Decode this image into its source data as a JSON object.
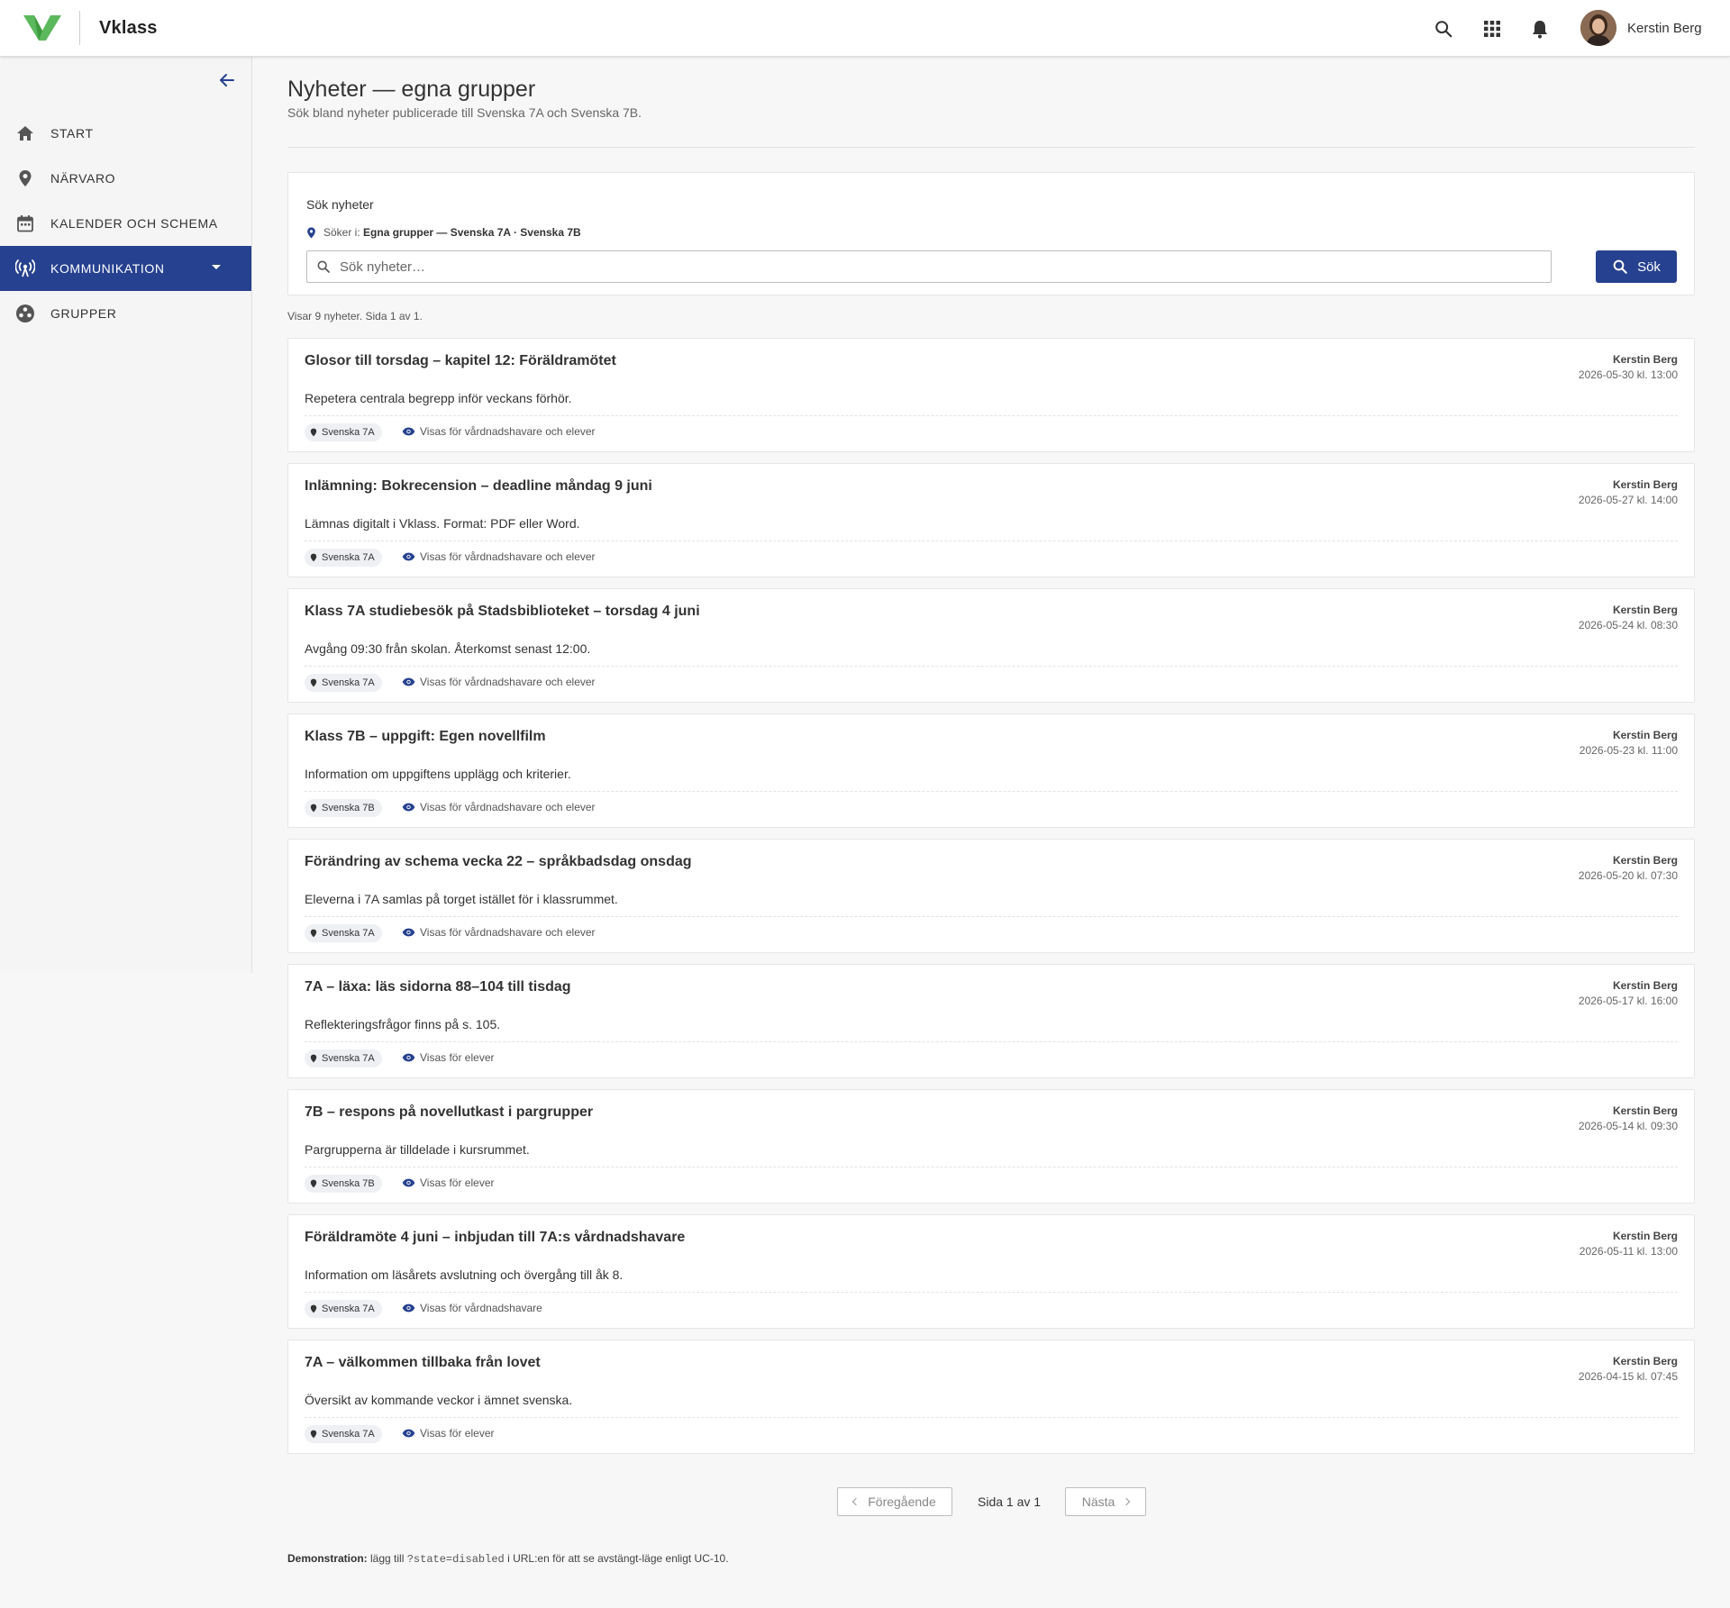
{
  "app": {
    "brand": "Vklass",
    "user_name": "Kerstin Berg"
  },
  "colors": {
    "primary": "#26418f",
    "logo_green": "#5cb85c"
  },
  "topbar_icons": [
    "search-icon",
    "apps-grid-icon",
    "bell-icon"
  ],
  "sidebar": {
    "items": [
      {
        "label": "START",
        "icon": "home-icon",
        "active": false
      },
      {
        "label": "NÄRVARO",
        "icon": "location-pin-icon",
        "active": false
      },
      {
        "label": "KALENDER OCH SCHEMA",
        "icon": "calendar-icon",
        "active": false
      },
      {
        "label": "KOMMUNIKATION",
        "icon": "broadcast-icon",
        "active": true
      },
      {
        "label": "GRUPPER",
        "icon": "groups-icon",
        "active": false
      }
    ]
  },
  "page": {
    "title": "Nyheter — egna grupper",
    "subtitle": "Sök bland nyheter publicerade till Svenska 7A och Svenska 7B."
  },
  "search": {
    "label": "Sök nyheter",
    "scope_prefix": "Söker i:",
    "scope_value": "Egna grupper — Svenska 7A · Svenska 7B",
    "placeholder": "Sök nyheter…",
    "value": "",
    "button": "Sök"
  },
  "results_info": "Visar 9 nyheter. Sida 1 av 1.",
  "news": [
    {
      "title": "Glosor till torsdag – kapitel 12: Föräldramötet",
      "author": "Kerstin Berg",
      "date": "2026-05-30 kl. 13:00",
      "body": "Repetera centrala begrepp inför veckans förhör.",
      "group": "Svenska 7A",
      "visibility": "Visas för vårdnadshavare och elever"
    },
    {
      "title": "Inlämning: Bokrecension – deadline måndag 9 juni",
      "author": "Kerstin Berg",
      "date": "2026-05-27 kl. 14:00",
      "body": "Lämnas digitalt i Vklass. Format: PDF eller Word.",
      "group": "Svenska 7A",
      "visibility": "Visas för vårdnadshavare och elever"
    },
    {
      "title": "Klass 7A studiebesök på Stadsbiblioteket – torsdag 4 juni",
      "author": "Kerstin Berg",
      "date": "2026-05-24 kl. 08:30",
      "body": "Avgång 09:30 från skolan. Återkomst senast 12:00.",
      "group": "Svenska 7A",
      "visibility": "Visas för vårdnadshavare och elever"
    },
    {
      "title": "Klass 7B – uppgift: Egen novellfilm",
      "author": "Kerstin Berg",
      "date": "2026-05-23 kl. 11:00",
      "body": "Information om uppgiftens upplägg och kriterier.",
      "group": "Svenska 7B",
      "visibility": "Visas för vårdnadshavare och elever"
    },
    {
      "title": "Förändring av schema vecka 22 – språkbadsdag onsdag",
      "author": "Kerstin Berg",
      "date": "2026-05-20 kl. 07:30",
      "body": "Eleverna i 7A samlas på torget istället för i klassrummet.",
      "group": "Svenska 7A",
      "visibility": "Visas för vårdnadshavare och elever"
    },
    {
      "title": "7A – läxa: läs sidorna 88–104 till tisdag",
      "author": "Kerstin Berg",
      "date": "2026-05-17 kl. 16:00",
      "body": "Reflekteringsfrågor finns på s. 105.",
      "group": "Svenska 7A",
      "visibility": "Visas för elever"
    },
    {
      "title": "7B – respons på novellutkast i pargrupper",
      "author": "Kerstin Berg",
      "date": "2026-05-14 kl. 09:30",
      "body": "Pargrupperna är tilldelade i kursrummet.",
      "group": "Svenska 7B",
      "visibility": "Visas för elever"
    },
    {
      "title": "Föräldramöte 4 juni – inbjudan till 7A:s vårdnadshavare",
      "author": "Kerstin Berg",
      "date": "2026-05-11 kl. 13:00",
      "body": "Information om läsårets avslutning och övergång till åk 8.",
      "group": "Svenska 7A",
      "visibility": "Visas för vårdnadshavare"
    },
    {
      "title": "7A – välkommen tillbaka från lovet",
      "author": "Kerstin Berg",
      "date": "2026-04-15 kl. 07:45",
      "body": "Översikt av kommande veckor i ämnet svenska.",
      "group": "Svenska 7A",
      "visibility": "Visas för elever"
    }
  ],
  "pagination": {
    "prev": "Föregående",
    "info": "Sida 1 av 1",
    "next": "Nästa"
  },
  "demo": {
    "label": "Demonstration:",
    "text_before": "lägg till",
    "code": "?state=disabled",
    "text_after": "i URL:en för att se avstängt-läge enligt UC-10."
  }
}
